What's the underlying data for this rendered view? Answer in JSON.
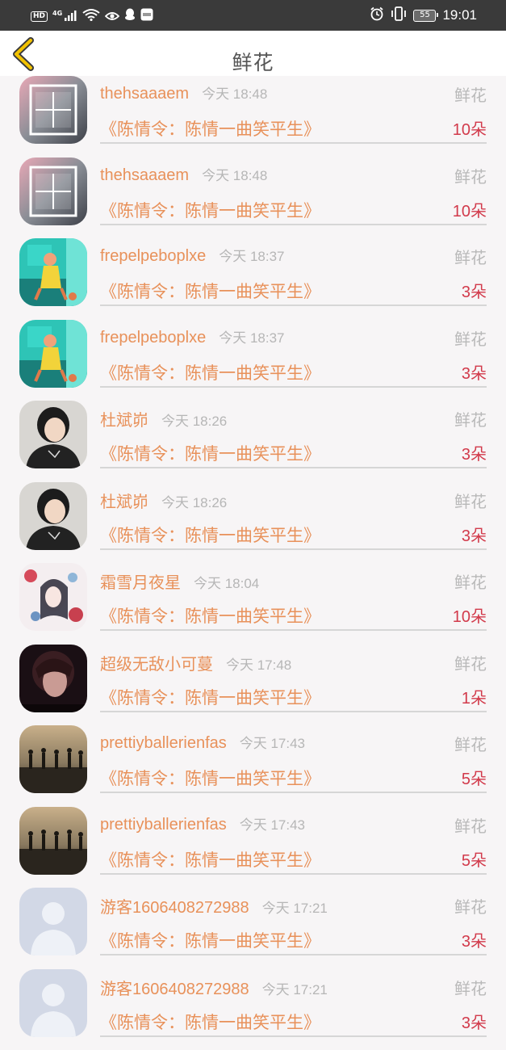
{
  "status_bar": {
    "hd": "HD",
    "network": "4G",
    "battery": "55",
    "time": "19:01"
  },
  "header": {
    "title": "鲜花"
  },
  "records": [
    {
      "name": "thehsaaaem",
      "time": "今天 18:48",
      "gift": "鲜花",
      "drama": "《陈情令：陈情一曲笑平生》",
      "count": "10朵",
      "avatar": "text-art"
    },
    {
      "name": "thehsaaaem",
      "time": "今天 18:48",
      "gift": "鲜花",
      "drama": "《陈情令：陈情一曲笑平生》",
      "count": "10朵",
      "avatar": "text-art"
    },
    {
      "name": "frepelpeboplxe",
      "time": "今天 18:37",
      "gift": "鲜花",
      "drama": "《陈情令：陈情一曲笑平生》",
      "count": "3朵",
      "avatar": "teal-illustration"
    },
    {
      "name": "frepelpeboplxe",
      "time": "今天 18:37",
      "gift": "鲜花",
      "drama": "《陈情令：陈情一曲笑平生》",
      "count": "3朵",
      "avatar": "teal-illustration"
    },
    {
      "name": "杜斌峁",
      "time": "今天 18:26",
      "gift": "鲜花",
      "drama": "《陈情令：陈情一曲笑平生》",
      "count": "3朵",
      "avatar": "person-dark-shirt"
    },
    {
      "name": "杜斌峁",
      "time": "今天 18:26",
      "gift": "鲜花",
      "drama": "《陈情令：陈情一曲笑平生》",
      "count": "3朵",
      "avatar": "person-dark-shirt"
    },
    {
      "name": "霜雪月夜星",
      "time": "今天 18:04",
      "gift": "鲜花",
      "drama": "《陈情令：陈情一曲笑平生》",
      "count": "10朵",
      "avatar": "floral-illustration"
    },
    {
      "name": "超级无敌小可蔓",
      "time": "今天 17:48",
      "gift": "鲜花",
      "drama": "《陈情令：陈情一曲笑平生》",
      "count": "1朵",
      "avatar": "dark-portrait"
    },
    {
      "name": "prettiyballerienfas",
      "time": "今天 17:43",
      "gift": "鲜花",
      "drama": "《陈情令：陈情一曲笑平生》",
      "count": "5朵",
      "avatar": "sunset-silhouettes"
    },
    {
      "name": "prettiyballerienfas",
      "time": "今天 17:43",
      "gift": "鲜花",
      "drama": "《陈情令：陈情一曲笑平生》",
      "count": "5朵",
      "avatar": "sunset-silhouettes"
    },
    {
      "name": "游客1606408272988",
      "time": "今天 17:21",
      "gift": "鲜花",
      "drama": "《陈情令：陈情一曲笑平生》",
      "count": "3朵",
      "avatar": "default-user"
    },
    {
      "name": "游客1606408272988",
      "time": "今天 17:21",
      "gift": "鲜花",
      "drama": "《陈情令：陈情一曲笑平生》",
      "count": "3朵",
      "avatar": "default-user"
    }
  ],
  "colors": {
    "name": "#e8915a",
    "count": "#d23a4b",
    "muted": "#b9b9b9",
    "back_arrow": "#f2c200"
  }
}
